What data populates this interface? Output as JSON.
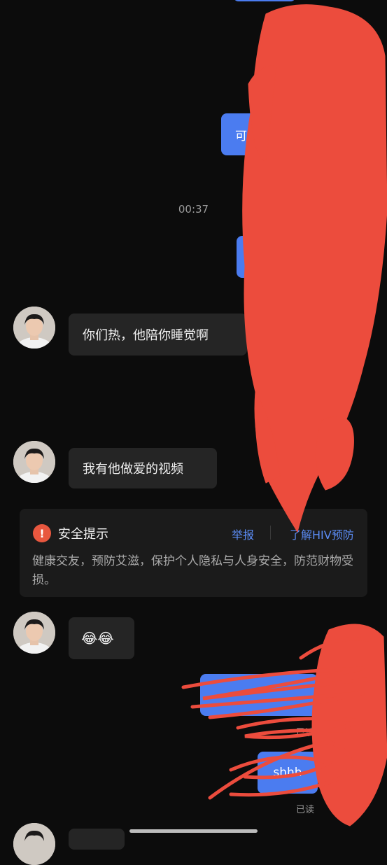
{
  "messages": {
    "read_label": "已读",
    "timestamp": "00:37",
    "incoming": [
      {
        "text": "你们热，他陪你睡觉啊"
      },
      {
        "text": "我有他做爱的视频"
      },
      {
        "text": "😂😂"
      }
    ],
    "outgoing_partial": [
      {
        "text": "可"
      },
      {
        "text": "shhh"
      }
    ]
  },
  "safety_tip": {
    "title": "安全提示",
    "report_label": "举报",
    "learn_label": "了解HIV预防",
    "body": "健康交友，预防艾滋，保护个人隐私与人身安全，防范财物受损。"
  },
  "colors": {
    "background": "#0c0c0c",
    "outgoing_bubble": "#4b7cf0",
    "incoming_bubble": "#252525",
    "link": "#5b8cf5",
    "warning": "#e8573f",
    "redaction": "#ec4c3d"
  }
}
